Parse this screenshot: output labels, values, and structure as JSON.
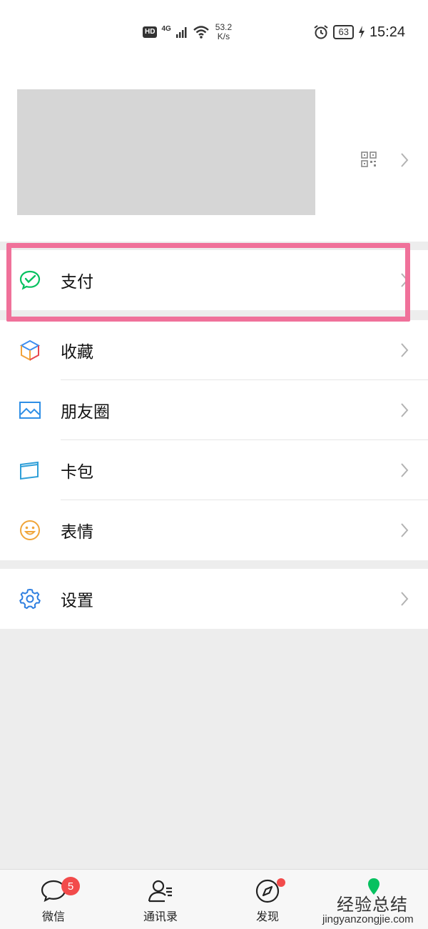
{
  "status_bar": {
    "hd": "HD",
    "network": "4G",
    "speed_value": "53.2",
    "speed_unit": "K/s",
    "battery": "63",
    "time": "15:24"
  },
  "profile": {
    "qr_icon": "qr-code-icon",
    "chevron_icon": "chevron-right-icon"
  },
  "menu": {
    "pay": {
      "label": "支付",
      "icon": "wechat-pay-icon"
    },
    "favorites": {
      "label": "收藏",
      "icon": "cube-icon"
    },
    "moments": {
      "label": "朋友圈",
      "icon": "image-icon"
    },
    "cards": {
      "label": "卡包",
      "icon": "wallet-card-icon"
    },
    "stickers": {
      "label": "表情",
      "icon": "smiley-icon"
    },
    "settings": {
      "label": "设置",
      "icon": "gear-icon"
    }
  },
  "colors": {
    "highlight": "#f0719a",
    "wechat_green": "#07c160",
    "badge_red": "#f24b4b"
  },
  "tabbar": {
    "chats": {
      "label": "微信",
      "badge": "5"
    },
    "contacts": {
      "label": "通讯录"
    },
    "discover": {
      "label": "发现"
    }
  },
  "watermark": {
    "title": "经验总结",
    "url": "jingyanzongjie.com"
  }
}
